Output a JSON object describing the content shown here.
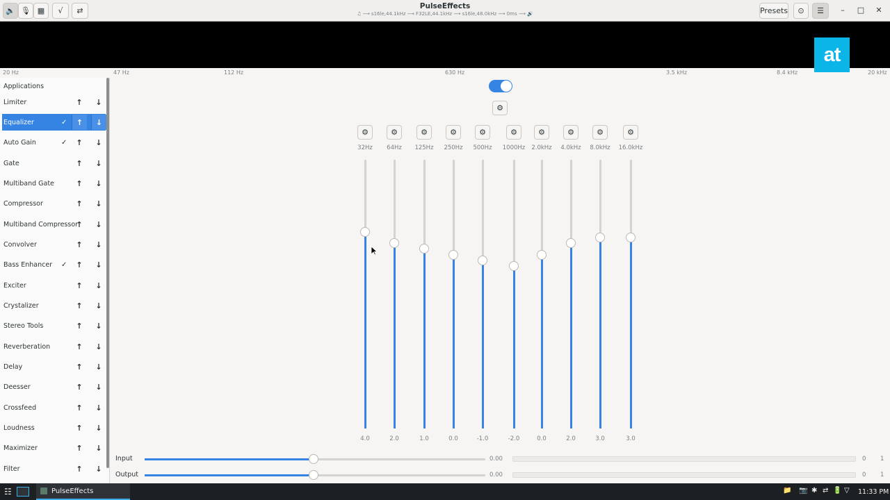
{
  "window": {
    "title": "PulseEffects",
    "subtitle": "♫ ⟶ s16le,44.1kHz ⟶ F32LE,44.1kHz ⟶ s16le,48.0kHz ⟶ 0ms ⟶ 🔊",
    "presets_label": "Presets"
  },
  "header": {
    "left_buttons": [
      {
        "name": "speaker-icon",
        "glyph": "🔈",
        "active": true
      },
      {
        "name": "microphone-icon",
        "glyph": "🎙",
        "active": false
      },
      {
        "name": "equalizer-grid-icon",
        "glyph": "▦",
        "active": false
      },
      {
        "name": "spectrum-icon",
        "glyph": "√",
        "active": false
      },
      {
        "name": "shuffle-icon",
        "glyph": "⇄",
        "active": false
      }
    ],
    "right_icons": {
      "headphones": "⊙",
      "menu": "☰",
      "minimize": "–",
      "maximize": "□",
      "close": "✕"
    }
  },
  "logo": {
    "text": "at",
    "color": "#0bb5e8"
  },
  "frequency_scale": [
    "20 Hz",
    "47 Hz",
    "112 Hz",
    "630 Hz",
    "3.5 kHz",
    "8.4 kHz",
    "20 kHz"
  ],
  "sidebar": {
    "header": "Applications",
    "items": [
      {
        "label": "Limiter",
        "enabled": false,
        "selected": false
      },
      {
        "label": "Equalizer",
        "enabled": true,
        "selected": true
      },
      {
        "label": "Auto Gain",
        "enabled": true,
        "selected": false
      },
      {
        "label": "Gate",
        "enabled": false,
        "selected": false
      },
      {
        "label": "Multiband Gate",
        "enabled": false,
        "selected": false
      },
      {
        "label": "Compressor",
        "enabled": false,
        "selected": false
      },
      {
        "label": "Multiband Compressor",
        "enabled": false,
        "selected": false
      },
      {
        "label": "Convolver",
        "enabled": false,
        "selected": false
      },
      {
        "label": "Bass Enhancer",
        "enabled": true,
        "selected": false
      },
      {
        "label": "Exciter",
        "enabled": false,
        "selected": false
      },
      {
        "label": "Crystalizer",
        "enabled": false,
        "selected": false
      },
      {
        "label": "Stereo Tools",
        "enabled": false,
        "selected": false
      },
      {
        "label": "Reverberation",
        "enabled": false,
        "selected": false
      },
      {
        "label": "Delay",
        "enabled": false,
        "selected": false
      },
      {
        "label": "Deesser",
        "enabled": false,
        "selected": false
      },
      {
        "label": "Crossfeed",
        "enabled": false,
        "selected": false
      },
      {
        "label": "Loudness",
        "enabled": false,
        "selected": false
      },
      {
        "label": "Maximizer",
        "enabled": false,
        "selected": false
      },
      {
        "label": "Filter",
        "enabled": false,
        "selected": false
      }
    ],
    "up_glyph": "↑",
    "down_glyph": "↓",
    "check_glyph": "✓"
  },
  "equalizer": {
    "enabled": true,
    "gear_glyph": "⚙",
    "range_db": [
      -24,
      24
    ],
    "bands": [
      {
        "freq": "32Hz",
        "gain": "4.0",
        "value": 4.0
      },
      {
        "freq": "64Hz",
        "gain": "2.0",
        "value": 2.0
      },
      {
        "freq": "125Hz",
        "gain": "1.0",
        "value": 1.0
      },
      {
        "freq": "250Hz",
        "gain": "0.0",
        "value": 0.0
      },
      {
        "freq": "500Hz",
        "gain": "-1.0",
        "value": -1.0
      },
      {
        "freq": "1000Hz",
        "gain": "-2.0",
        "value": -2.0
      },
      {
        "freq": "2.0kHz",
        "gain": "0.0",
        "value": 0.0
      },
      {
        "freq": "4.0kHz",
        "gain": "2.0",
        "value": 2.0
      },
      {
        "freq": "8.0kHz",
        "gain": "3.0",
        "value": 3.0
      },
      {
        "freq": "16.0kHz",
        "gain": "3.0",
        "value": 3.0
      }
    ]
  },
  "io": {
    "input": {
      "label": "Input",
      "value": "0.00",
      "level": "0",
      "max": "1",
      "fraction": 0.5
    },
    "output": {
      "label": "Output",
      "value": "0.00",
      "level": "0",
      "max": "1",
      "fraction": 0.5
    }
  },
  "taskbar": {
    "task_label": "PulseEffects",
    "clock": "11:33 PM",
    "launcher_glyph": "☷",
    "tray": [
      "📁",
      "📷",
      "✱",
      "⇄",
      "🔋",
      "▽",
      "🔊"
    ]
  }
}
